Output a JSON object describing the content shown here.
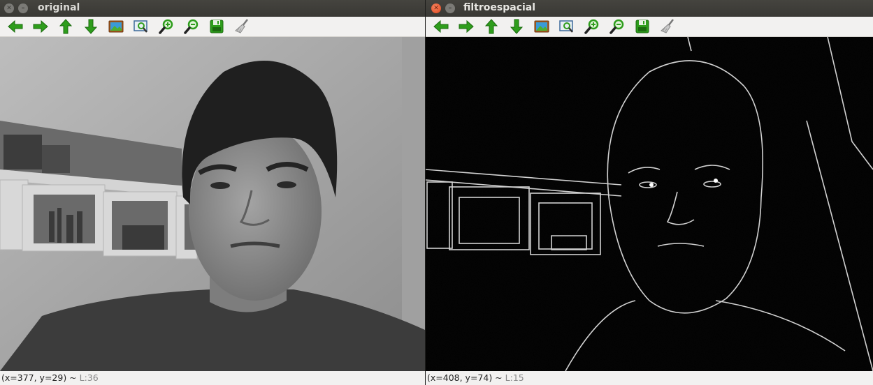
{
  "windows": {
    "left": {
      "title": "original",
      "active": false,
      "status": {
        "coords": "(x=377, y=29) ~ ",
        "level": "L:36"
      },
      "image_alt": "grayscale webcam frame of a young man in front of white shelves"
    },
    "right": {
      "title": "filtroespacial",
      "active": true,
      "status": {
        "coords": "(x=408, y=74) ~ ",
        "level": "L:15"
      },
      "image_alt": "edge-filtered frame showing white contour lines on black"
    }
  },
  "toolbar": [
    {
      "name": "pan-left",
      "icon": "arrow-left-icon"
    },
    {
      "name": "pan-right",
      "icon": "arrow-right-icon"
    },
    {
      "name": "pan-up",
      "icon": "arrow-up-icon"
    },
    {
      "name": "pan-down",
      "icon": "arrow-down-icon"
    },
    {
      "name": "zoom-original",
      "icon": "picture-icon"
    },
    {
      "name": "zoom-fit",
      "icon": "zoom-fit-icon"
    },
    {
      "name": "zoom-in",
      "icon": "zoom-in-icon"
    },
    {
      "name": "zoom-out",
      "icon": "zoom-out-icon"
    },
    {
      "name": "save",
      "icon": "save-icon"
    },
    {
      "name": "properties",
      "icon": "brush-icon"
    }
  ],
  "colors": {
    "titlebar": "#3c3b37",
    "arrow_green": "#2e9d1c",
    "close_orange": "#e95420"
  }
}
